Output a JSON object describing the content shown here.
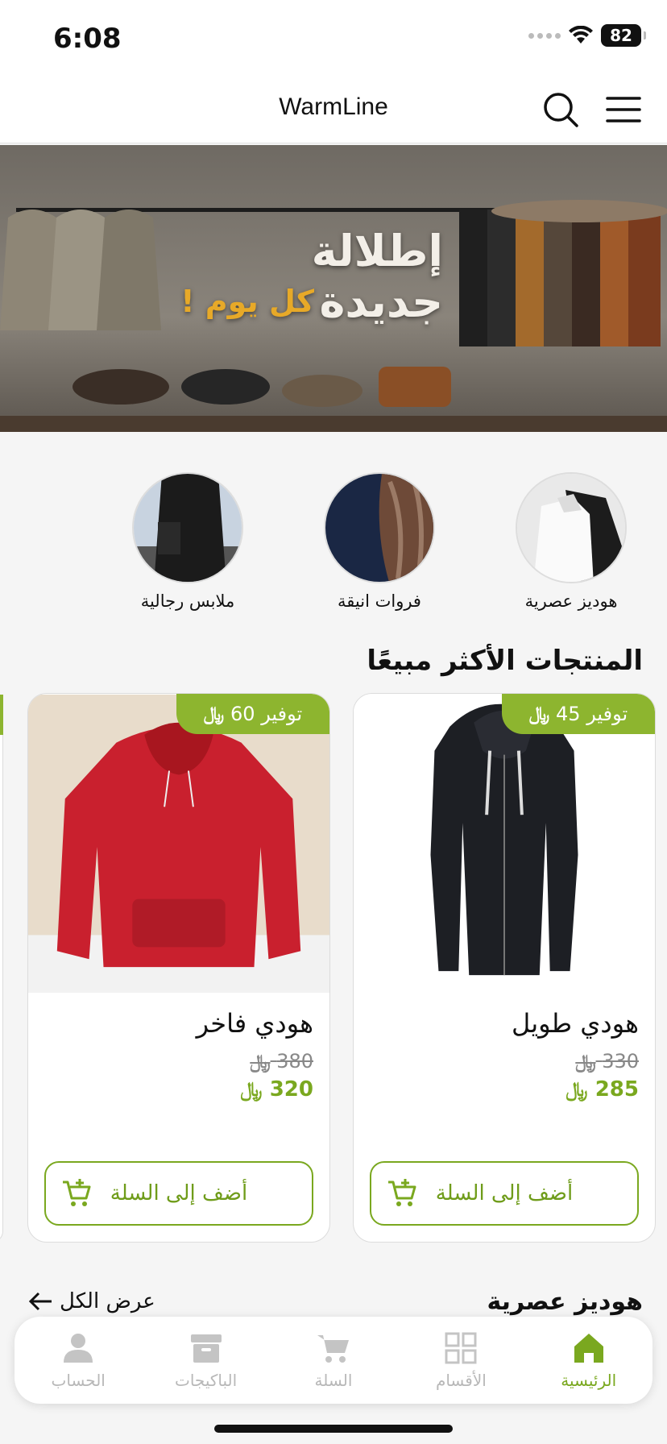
{
  "status_bar": {
    "time": "6:08",
    "battery": "82"
  },
  "header": {
    "title": "WarmLine"
  },
  "banner": {
    "title": "إطلالة جديدة",
    "subtitle": "كل يوم !"
  },
  "categories": [
    {
      "label": "هوديز عصرية"
    },
    {
      "label": "فروات انيقة"
    },
    {
      "label": "ملابس رجالية"
    }
  ],
  "best_sellers": {
    "title": "المنتجات الأكثر مبيعًا",
    "currency_symbol": "﷼",
    "products": [
      {
        "name": "هودي طويل",
        "old_price": "330",
        "new_price": "285",
        "badge": "توفير 45",
        "button": "أضف إلى السلة"
      },
      {
        "name": "هودي فاخر",
        "old_price": "380",
        "new_price": "320",
        "badge": "توفير 60",
        "button": "أضف إلى السلة"
      }
    ]
  },
  "section2": {
    "title": "هوديز عصرية",
    "view_all": "عرض الكل"
  },
  "bottom_nav": [
    {
      "label": "الرئيسية",
      "icon": "home-icon",
      "active": true
    },
    {
      "label": "الأقسام",
      "icon": "grid-icon",
      "active": false
    },
    {
      "label": "السلة",
      "icon": "cart-icon",
      "active": false
    },
    {
      "label": "الباكيجات",
      "icon": "package-icon",
      "active": false
    },
    {
      "label": "الحساب",
      "icon": "account-icon",
      "active": false
    }
  ],
  "colors": {
    "accent": "#7aa81f",
    "badge": "#8db52f",
    "inactive": "#b8b8b8"
  }
}
